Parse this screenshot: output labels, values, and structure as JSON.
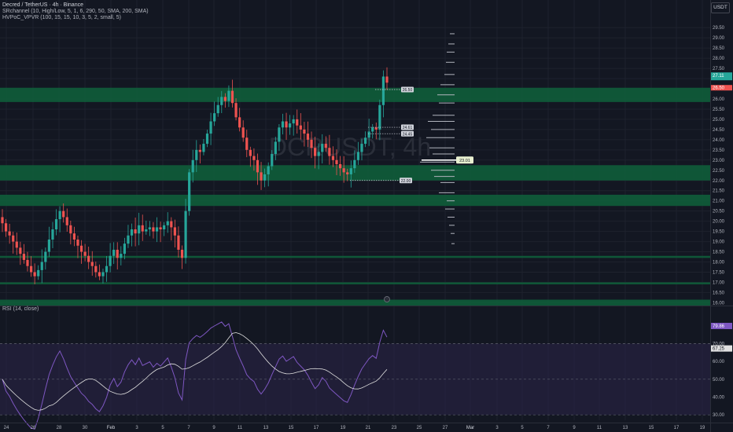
{
  "header": {
    "title": "Decred / TetherUS · 4h · Binance",
    "indicator1": "SRchannel (10, High/Low, 5, 1, 6, 290, 50, SMA, 200, SMA)",
    "indicator2": "HVPoC_VPVR (100, 15, 15, 10, 3, 5, 2, small, 5)"
  },
  "watermark": "DCRUSDT, 4h",
  "currency_button": "USDT",
  "rsi_label": "RSI (14, close)",
  "colors": {
    "background": "#131722",
    "up_candle": "#26a69a",
    "down_candle": "#ef5350",
    "sr_zone": "#0f5c39",
    "rsi_line": "#7e57c2",
    "rsi_band": "#2b2548",
    "rsi_ma": "#e0e0e0"
  },
  "chart_data": [
    {
      "type": "candlestick",
      "symbol": "DCRUSDT",
      "interval": "4h",
      "ylim": [
        15.9,
        29.7
      ],
      "y_ticks": [
        "29.50",
        "29.00",
        "28.50",
        "28.00",
        "27.50",
        "27.00",
        "26.50",
        "26.00",
        "25.50",
        "25.00",
        "24.50",
        "24.00",
        "23.50",
        "23.00",
        "22.50",
        "22.00",
        "21.50",
        "21.00",
        "20.50",
        "20.00",
        "19.50",
        "19.00",
        "18.50",
        "18.00",
        "17.50",
        "17.00",
        "16.50",
        "16.00"
      ],
      "x_ticks": [
        "24",
        "26",
        "28",
        "30",
        "Feb",
        "3",
        "5",
        "7",
        "9",
        "11",
        "13",
        "15",
        "17",
        "19",
        "21",
        "23",
        "25",
        "27",
        "Mar",
        "3",
        "5",
        "7",
        "9",
        "11",
        "13",
        "15",
        "17",
        "19"
      ],
      "x_tick_pos": [
        8,
        42,
        75,
        108,
        141,
        174,
        207,
        240,
        272,
        305,
        338,
        370,
        402,
        436,
        468,
        501,
        533,
        566,
        598,
        632,
        664,
        697,
        730,
        762,
        795,
        828,
        860,
        893
      ],
      "sr_zones": [
        [
          25.85,
          26.55
        ],
        [
          22.0,
          22.75
        ],
        [
          20.75,
          21.3
        ],
        [
          18.2,
          18.3
        ],
        [
          16.9,
          17.0
        ],
        [
          15.85,
          16.15
        ]
      ],
      "closes": [
        19.9,
        19.5,
        19.3,
        19.0,
        18.7,
        18.4,
        18.1,
        17.8,
        17.5,
        17.3,
        17.6,
        18.0,
        18.5,
        19.1,
        19.6,
        20.1,
        20.5,
        20.2,
        19.8,
        19.4,
        19.1,
        18.8,
        18.5,
        18.3,
        18.0,
        17.8,
        17.5,
        17.3,
        17.5,
        17.8,
        18.3,
        18.6,
        18.2,
        18.4,
        18.9,
        19.3,
        19.6,
        19.4,
        19.8,
        19.5,
        19.6,
        19.7,
        19.5,
        19.7,
        19.6,
        19.8,
        20.0,
        19.7,
        19.3,
        18.6,
        18.2,
        20.5,
        22.4,
        23.0,
        23.5,
        23.4,
        23.8,
        24.3,
        24.9,
        25.3,
        25.7,
        26.1,
        25.9,
        26.4,
        25.8,
        25.1,
        24.6,
        24.1,
        23.5,
        23.2,
        23.0,
        22.4,
        22.0,
        22.3,
        22.7,
        23.3,
        23.9,
        24.6,
        24.9,
        24.6,
        24.8,
        25.0,
        24.7,
        24.5,
        24.3,
        24.0,
        23.6,
        23.2,
        23.4,
        23.8,
        23.6,
        23.2,
        23.0,
        22.8,
        22.6,
        22.4,
        22.3,
        22.6,
        23.0,
        23.4,
        23.8,
        24.1,
        24.4,
        24.6,
        24.5,
        25.7,
        27.1,
        26.8
      ],
      "last_price": "27.11",
      "markers": [
        "26.50",
        "24.61",
        "24.45",
        "23.01",
        "22.00"
      ],
      "volume_profile_price": "23.01"
    },
    {
      "type": "line",
      "name": "RSI (14, close)",
      "ylim": [
        27,
        90
      ],
      "y_ticks": [
        "80.00",
        "70.00",
        "60.00",
        "50.00",
        "40.00",
        "30.00"
      ],
      "band": [
        30,
        70
      ],
      "midline": 50,
      "last_value": "79.86",
      "ma_last_value": "67.25"
    }
  ]
}
